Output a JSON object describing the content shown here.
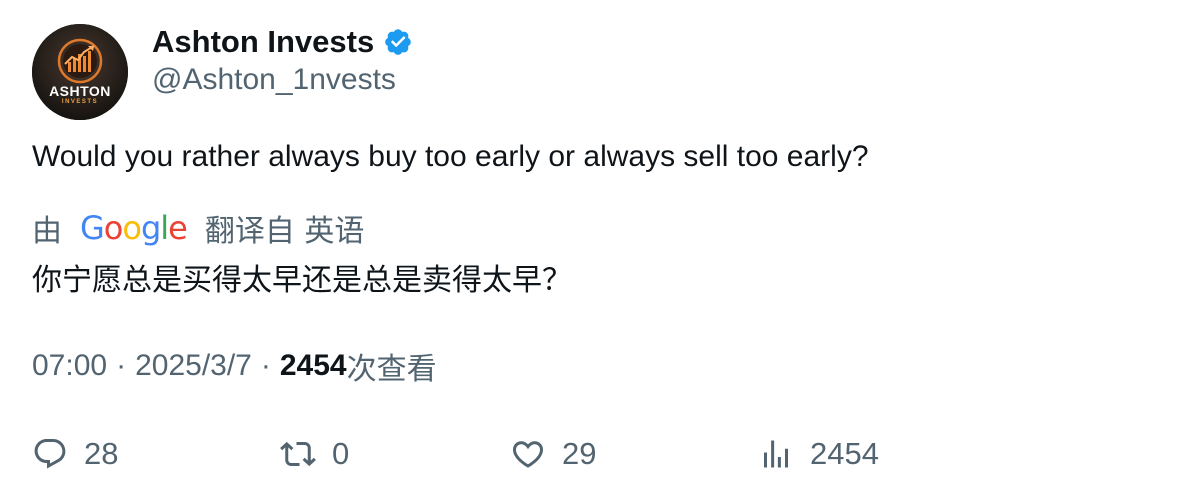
{
  "author": {
    "display_name": "Ashton Invests",
    "handle": "@Ashton_1nvests",
    "verified": true,
    "avatar_brand": "ASHTON",
    "avatar_sub": "INVESTS",
    "verified_color": "#1d9bf0"
  },
  "tweet": {
    "text": "Would you rather always buy too early or always sell too early?"
  },
  "translation": {
    "by_label": "由",
    "google_letters": [
      "G",
      "o",
      "o",
      "g",
      "l",
      "e"
    ],
    "google_colors": [
      "#4285F4",
      "#EA4335",
      "#FBBC05",
      "#4285F4",
      "#34A853",
      "#EA4335"
    ],
    "from_label": "翻译自 英语",
    "text": "你宁愿总是买得太早还是总是卖得太早？"
  },
  "meta": {
    "time": "07:00",
    "separator": "·",
    "date": "2025/3/7",
    "views_count": "2454",
    "views_label": "次查看"
  },
  "actions": {
    "replies": "28",
    "retweets": "0",
    "likes": "29",
    "views": "2454"
  },
  "colors": {
    "text_primary": "#0f1419",
    "text_secondary": "#536471"
  },
  "icons": {
    "reply": "reply-icon",
    "retweet": "retweet-icon",
    "like": "heart-icon",
    "views": "analytics-icon",
    "verified": "verified-badge-icon"
  }
}
